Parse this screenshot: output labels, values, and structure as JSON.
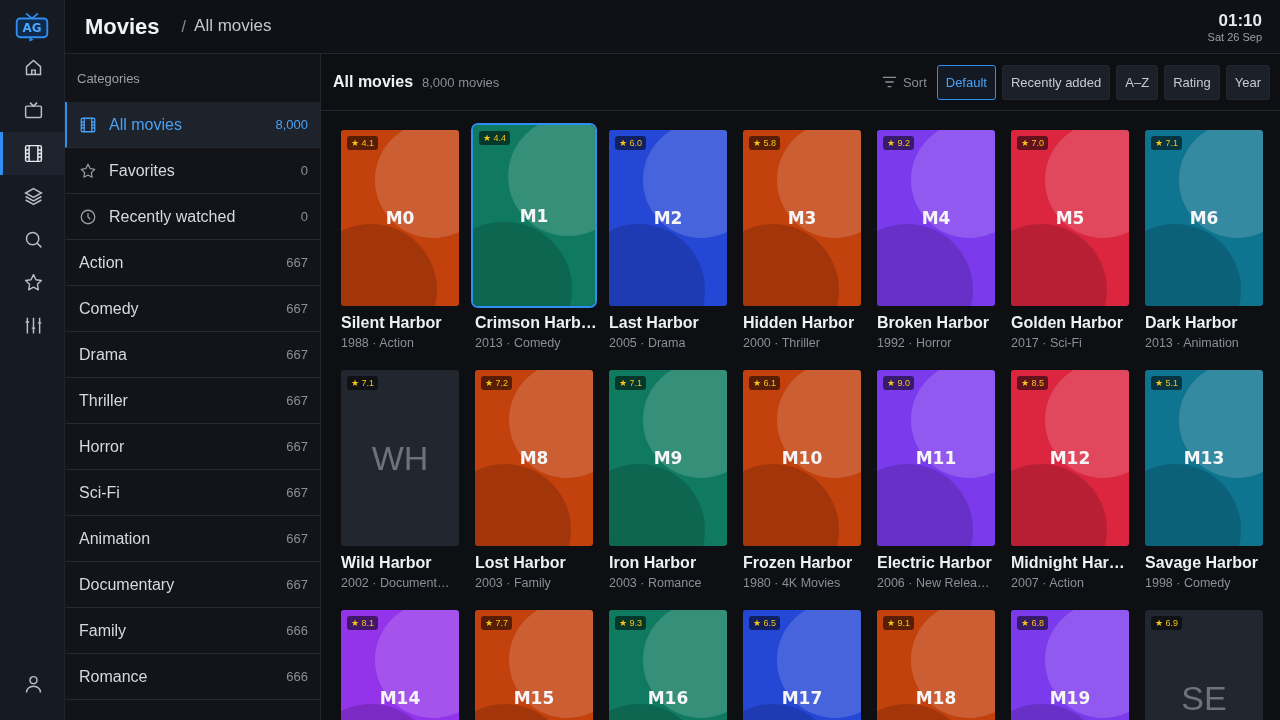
{
  "logo": {
    "text": "AG"
  },
  "rail": [
    {
      "kind": "home",
      "selected": false
    },
    {
      "kind": "tv",
      "selected": false
    },
    {
      "kind": "film",
      "selected": true
    },
    {
      "kind": "layers",
      "selected": false
    },
    {
      "kind": "search",
      "selected": false
    },
    {
      "kind": "star",
      "selected": false
    },
    {
      "kind": "sliders",
      "selected": false
    }
  ],
  "header": {
    "title": "Movies",
    "separator": "/",
    "breadcrumb": "All movies",
    "time": "01:10",
    "date": "Sat 26 Sep"
  },
  "categories": {
    "heading": "Categories",
    "items": [
      {
        "label": "All movies",
        "count": "8,000",
        "kind": "film",
        "selected": true
      },
      {
        "label": "Favorites",
        "count": "0",
        "kind": "star",
        "selected": false
      },
      {
        "label": "Recently watched",
        "count": "0",
        "kind": "clock",
        "selected": false
      },
      {
        "label": "Action",
        "count": "667",
        "selected": false
      },
      {
        "label": "Comedy",
        "count": "667",
        "selected": false
      },
      {
        "label": "Drama",
        "count": "667",
        "selected": false
      },
      {
        "label": "Thriller",
        "count": "667",
        "selected": false
      },
      {
        "label": "Horror",
        "count": "667",
        "selected": false
      },
      {
        "label": "Sci-Fi",
        "count": "667",
        "selected": false
      },
      {
        "label": "Animation",
        "count": "667",
        "selected": false
      },
      {
        "label": "Documentary",
        "count": "667",
        "selected": false
      },
      {
        "label": "Family",
        "count": "666",
        "selected": false
      },
      {
        "label": "Romance",
        "count": "666",
        "selected": false
      }
    ]
  },
  "toolbar": {
    "title": "All movies",
    "count": "8,000 movies",
    "sort_label": "Sort",
    "sort_options": [
      {
        "label": "Default",
        "selected": true
      },
      {
        "label": "Recently added",
        "selected": false
      },
      {
        "label": "A–Z",
        "selected": false
      },
      {
        "label": "Rating",
        "selected": false
      },
      {
        "label": "Year",
        "selected": false
      }
    ]
  },
  "movies": [
    {
      "kind": "art",
      "label": "M0",
      "rating": "★ 4.1",
      "title": "Silent Harbor",
      "meta": "1988 · Action",
      "color": "#c2410c",
      "selected": false
    },
    {
      "kind": "art",
      "label": "M1",
      "rating": "★ 4.4",
      "title": "Crimson Harb…",
      "meta": "2013 · Comedy",
      "color": "#0f7a60",
      "selected": true
    },
    {
      "kind": "art",
      "label": "M2",
      "rating": "★ 6.0",
      "title": "Last Harbor",
      "meta": "2005 · Drama",
      "color": "#2447d6",
      "selected": false
    },
    {
      "kind": "art",
      "label": "M3",
      "rating": "★ 5.8",
      "title": "Hidden Harbor",
      "meta": "2000 · Thriller",
      "color": "#c2410c",
      "selected": false
    },
    {
      "kind": "art",
      "label": "M4",
      "rating": "★ 9.2",
      "title": "Broken Harbor",
      "meta": "1992 · Horror",
      "color": "#7c3aed",
      "selected": false
    },
    {
      "kind": "art",
      "label": "M5",
      "rating": "★ 7.0",
      "title": "Golden Harbor",
      "meta": "2017 · Sci-Fi",
      "color": "#dc2640",
      "selected": false
    },
    {
      "kind": "art",
      "label": "M6",
      "rating": "★ 7.1",
      "title": "Dark Harbor",
      "meta": "2013 · Animation",
      "color": "#0e7490",
      "selected": false
    },
    {
      "kind": "placeholder",
      "label": "WH",
      "rating": "★ 7.1",
      "title": "Wild Harbor",
      "meta": "2002 · Document…",
      "selected": false
    },
    {
      "kind": "art",
      "label": "M8",
      "rating": "★ 7.2",
      "title": "Lost Harbor",
      "meta": "2003 · Family",
      "color": "#c2410c",
      "selected": false
    },
    {
      "kind": "art",
      "label": "M9",
      "rating": "★ 7.1",
      "title": "Iron Harbor",
      "meta": "2003 · Romance",
      "color": "#0f7a60",
      "selected": false
    },
    {
      "kind": "art",
      "label": "M10",
      "rating": "★ 6.1",
      "title": "Frozen Harbor",
      "meta": "1980 · 4K Movies",
      "color": "#c2410c",
      "selected": false
    },
    {
      "kind": "art",
      "label": "M11",
      "rating": "★ 9.0",
      "title": "Electric Harbor",
      "meta": "2006 · New Relea…",
      "color": "#7c3aed",
      "selected": false
    },
    {
      "kind": "art",
      "label": "M12",
      "rating": "★ 8.5",
      "title": "Midnight Har…",
      "meta": "2007 · Action",
      "color": "#dc2640",
      "selected": false
    },
    {
      "kind": "art",
      "label": "M13",
      "rating": "★ 5.1",
      "title": "Savage Harbor",
      "meta": "1998 · Comedy",
      "color": "#0e7490",
      "selected": false
    },
    {
      "kind": "art",
      "label": "M14",
      "rating": "★ 8.1",
      "color": "#9333ea",
      "selected": false
    },
    {
      "kind": "art",
      "label": "M15",
      "rating": "★ 7.7",
      "color": "#c2410c",
      "selected": false
    },
    {
      "kind": "art",
      "label": "M16",
      "rating": "★ 9.3",
      "color": "#0f7a60",
      "selected": false
    },
    {
      "kind": "art",
      "label": "M17",
      "rating": "★ 6.5",
      "color": "#2447d6",
      "selected": false
    },
    {
      "kind": "art",
      "label": "M18",
      "rating": "★ 9.1",
      "color": "#c2410c",
      "selected": false
    },
    {
      "kind": "art",
      "label": "M19",
      "rating": "★ 6.8",
      "color": "#7c3aed",
      "selected": false
    },
    {
      "kind": "placeholder",
      "label": "SE",
      "rating": "★ 6.9",
      "selected": false
    }
  ]
}
